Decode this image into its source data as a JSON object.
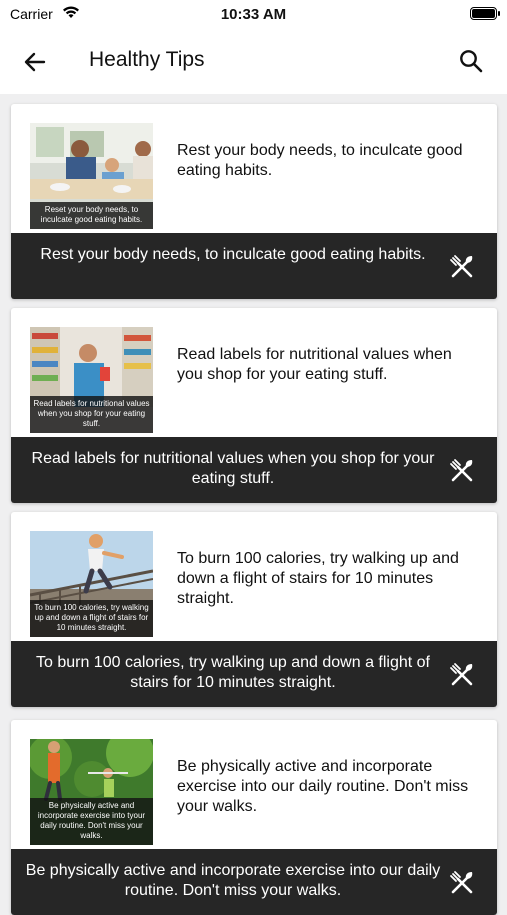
{
  "status": {
    "carrier": "Carrier",
    "time": "10:33 AM"
  },
  "nav": {
    "title": "Healthy Tips"
  },
  "tips": [
    {
      "thumb_caption": "Reset your body needs, to inculcate good eating habits.",
      "text": "Rest your body needs, to inculcate good eating habits.",
      "bar_text": "Rest your body needs, to inculcate good eating habits."
    },
    {
      "thumb_caption": "Read labels for nutritional values when you shop for your eating stuff.",
      "text": "Read labels for nutritional values when you shop for your eating stuff.",
      "bar_text": "Read labels for nutritional values when you shop for your eating stuff."
    },
    {
      "thumb_caption": "To burn 100 calories, try walking up and down a flight of stairs for 10 minutes straight.",
      "text": "To burn 100 calories, try walking up and down a flight of stairs for 10 minutes straight.",
      "bar_text": "To burn 100 calories, try walking up and down a flight of stairs for 10 minutes straight."
    },
    {
      "thumb_caption": "Be physically active and incorporate exercise into tyour daily routine. Don't miss your walks.",
      "text": "Be physically active and incorporate exercise into our daily routine. Don't miss your walks.",
      "bar_text": "Be physically active and incorporate exercise into our daily routine. Don't miss your walks."
    }
  ],
  "icons": {
    "back": "arrow-left-icon",
    "search": "search-icon",
    "tip": "fork-knife-icon"
  },
  "colors": {
    "card_bar": "#262626",
    "background": "#efeff0"
  }
}
